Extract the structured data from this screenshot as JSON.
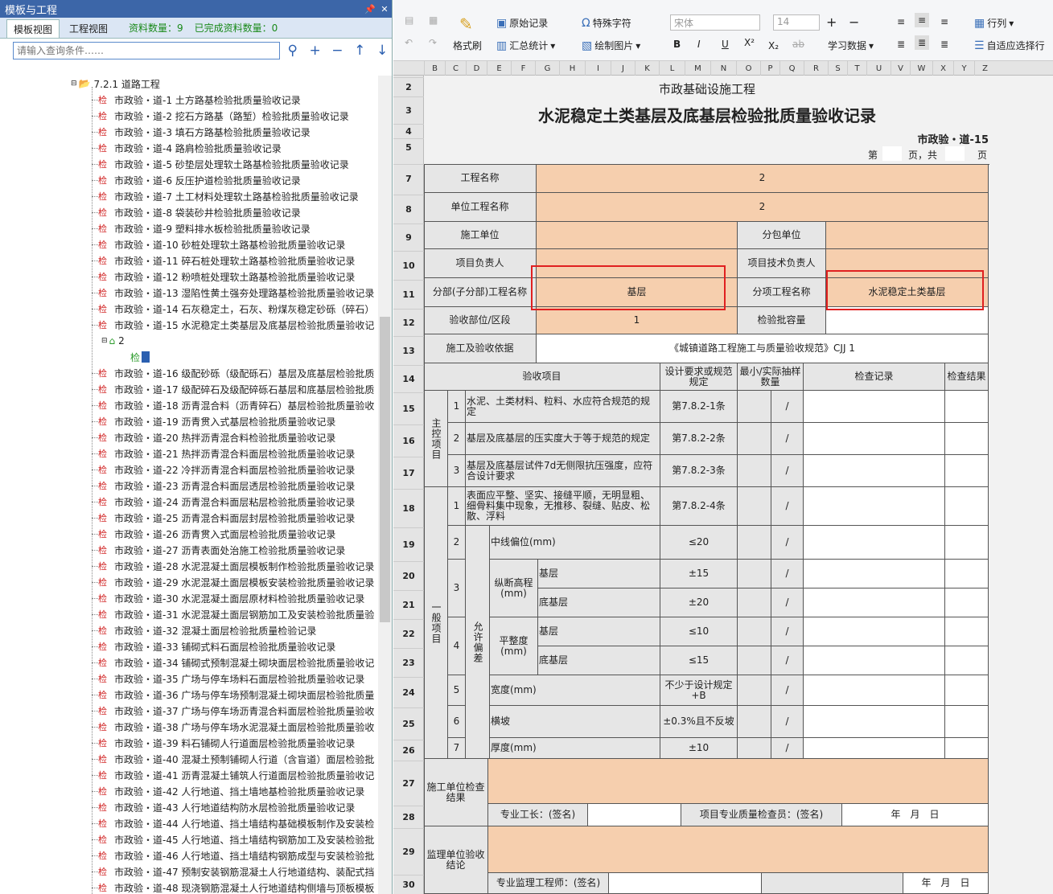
{
  "panel": {
    "title": "模板与工程",
    "tabs": [
      "模板视图",
      "工程视图"
    ],
    "count_label": "资料数量：9",
    "done_label": "已完成资料数量：0",
    "search_placeholder": "请输入查询条件……"
  },
  "tree": {
    "folder": "7.2.1 道路工程",
    "tag": "检",
    "items": [
      "市政验・道-1 土方路基检验批质量验收记录",
      "市政验・道-2 挖石方路基（路堑）检验批质量验收记录",
      "市政验・道-3 填石方路基检验批质量验收记录",
      "市政验・道-4 路肩检验批质量验收记录",
      "市政验・道-5 砂垫层处理软土路基检验批质量验收记录",
      "市政验・道-6 反压护道检验批质量验收记录",
      "市政验・道-7 土工材料处理软土路基检验批质量验收记录",
      "市政验・道-8 袋装砂井检验批质量验收记录",
      "市政验・道-9 塑料排水板检验批质量验收记录",
      "市政验・道-10 砂桩处理软土路基检验批质量验收记录",
      "市政验・道-11 碎石桩处理软土路基检验批质量验收记录",
      "市政验・道-12 粉喷桩处理软土路基检验批质量验收记录",
      "市政验・道-13 湿陷性黄土强夯处理路基检验批质量验收记录",
      "市政验・道-14 石灰稳定土，石灰、粉煤灰稳定砂砾（碎石）",
      "市政验・道-15 水泥稳定土类基层及底基层检验批质量验收记"
    ],
    "child": "2",
    "sub": "检",
    "items2": [
      "市政验・道-16 级配砂砾（级配砾石）基层及底基层检验批质",
      "市政验・道-17 级配碎石及级配碎砾石基层和底基层检验批质",
      "市政验・道-18 沥青混合料（沥青碎石）基层检验批质量验收",
      "市政验・道-19 沥青贯入式基层检验批质量验收记录",
      "市政验・道-20 热拌沥青混合料检验批质量验收记录",
      "市政验・道-21 热拌沥青混合料面层检验批质量验收记录",
      "市政验・道-22 冷拌沥青混合料面层检验批质量验收记录",
      "市政验・道-23 沥青混合料面层透层检验批质量验收记录",
      "市政验・道-24 沥青混合料面层粘层检验批质量验收记录",
      "市政验・道-25 沥青混合料面层封层检验批质量验收记录",
      "市政验・道-26 沥青贯入式面层检验批质量验收记录",
      "市政验・道-27 沥青表面处治施工检验批质量验收记录",
      "市政验・道-28 水泥混凝土面层模板制作检验批质量验收记录",
      "市政验・道-29 水泥混凝土面层模板安装检验批质量验收记录",
      "市政验・道-30 水泥混凝土面层原材料检验批质量验收记录",
      "市政验・道-31 水泥混凝土面层钢筋加工及安装检验批质量验",
      "市政验・道-32 混凝土面层检验批质量检验记录",
      "市政验・道-33 铺砌式料石面层检验批质量验收记录",
      "市政验・道-34 铺砌式预制混凝土砌块面层检验批质量验收记",
      "市政验・道-35 广场与停车场料石面层检验批质量验收记录",
      "市政验・道-36 广场与停车场预制混凝土砌块面层检验批质量",
      "市政验・道-37 广场与停车场沥青混合料面层检验批质量验收",
      "市政验・道-38 广场与停车场水泥混凝土面层检验批质量验收",
      "市政验・道-39 料石铺砌人行道面层检验批质量验收记录",
      "市政验・道-40 混凝土预制铺砌人行道（含盲道）面层检验批",
      "市政验・道-41 沥青混凝土铺筑人行道面层检验批质量验收记",
      "市政验・道-42 人行地道、挡土墙地基检验批质量验收记录",
      "市政验・道-43 人行地道结构防水层检验批质量验收记录",
      "市政验・道-44 人行地道、挡土墙结构基础模板制作及安装检",
      "市政验・道-45 人行地道、挡土墙结构钢筋加工及安装检验批",
      "市政验・道-46 人行地道、挡土墙结构钢筋成型与安装检验批",
      "市政验・道-47 预制安装钢筋混凝土人行地道结构、装配式挡",
      "市政验・道-48 现浇钢筋混凝土人行地道结构侧墙与顶板模板"
    ]
  },
  "ribbon": {
    "format_brush": "格式刷",
    "original_record": "原始记录",
    "summary_stats": "汇总统计",
    "special_char": "特殊字符",
    "draw_image": "绘制图片",
    "font_name": "宋体",
    "font_size": "14",
    "learn_data": "学习数据",
    "row_col": "行列",
    "auto_select": "自适应选择行"
  },
  "columns": [
    "B",
    "C",
    "D",
    "E",
    "F",
    "G",
    "H",
    "I",
    "J",
    "K",
    "L",
    "M",
    "N",
    "O",
    "P",
    "Q",
    "R",
    "S",
    "T",
    "U",
    "V",
    "W",
    "X",
    "Y",
    "Z"
  ],
  "rows": [
    "2",
    "3",
    "4",
    "5",
    "7",
    "8",
    "9",
    "10",
    "11",
    "12",
    "13",
    "14",
    "15",
    "16",
    "17",
    "18",
    "19",
    "20",
    "21",
    "22",
    "23",
    "24",
    "25",
    "26",
    "27",
    "28",
    "29",
    "30"
  ],
  "sheet": {
    "t1": "市政基础设施工程",
    "t2": "水泥稳定土类基层及底基层检验批质量验收记录",
    "code": "市政验・道-15",
    "page_di": "第",
    "page_ye_gong": "页，共",
    "page_ye": "页",
    "lbl_project": "工程名称",
    "val_project": "2",
    "lbl_unit": "单位工程名称",
    "val_unit": "2",
    "lbl_constructor": "施工单位",
    "lbl_sub": "分包单位",
    "lbl_pm": "项目负责人",
    "lbl_tech": "项目技术负责人",
    "lbl_div": "分部(子分部)工程名称",
    "val_div": "基层",
    "lbl_item": "分项工程名称",
    "val_item": "水泥稳定土类基层",
    "lbl_part": "验收部位/区段",
    "val_part": "1",
    "lbl_cap": "检验批容量",
    "lbl_basis": "施工及验收依据",
    "val_basis": "《城镇道路工程施工与质量验收规范》CJJ 1",
    "h_item": "验收项目",
    "h_design": "设计要求或规范规定",
    "h_min": "最小/实际抽样数量",
    "h_record": "检查记录",
    "h_result": "检查结果",
    "main": "主控项目",
    "general": "一般项目",
    "tolerance": "允许偏差",
    "m1": "水泥、土类材料、粒料、水应符合规范的规定",
    "m1s": "第7.8.2-1条",
    "m2": "基层及底基层的压实度大于等于规范的规定",
    "m2s": "第7.8.2-2条",
    "m3": "基层及底基层试件7d无侧限抗压强度，应符合设计要求",
    "m3s": "第7.8.2-3条",
    "g1": "表面应平整、坚实、接缝平顺，无明显粗、细骨料集中现象，无推移、裂缝、贴皮、松散、浮料",
    "g1s": "第7.8.2-4条",
    "g2": "中线偏位(mm)",
    "g2s": "≤20",
    "g3": "纵断高程(mm)",
    "base": "基层",
    "subbase": "底基层",
    "g3a": "±15",
    "g3b": "±20",
    "g4": "平整度(mm)",
    "g4a": "≤10",
    "g4b": "≤15",
    "g5": "宽度(mm)",
    "g5s": "不少于设计规定+B",
    "g6": "横坡",
    "g6s": "±0.3%且不反坡",
    "g7": "厚度(mm)",
    "g7s": "±10",
    "slash": "/",
    "n1": "1",
    "n2": "2",
    "n3": "3",
    "n4": "4",
    "n5": "5",
    "n6": "6",
    "n7": "7",
    "check_result": "施工单位检查结果",
    "foreman": "专业工长：(签名)",
    "inspector": "项目专业质量检查员：(签名)",
    "ymd": "年　月　日",
    "supervise": "监理单位验收结论",
    "supervisor": "专业监理工程师：(签名)"
  }
}
